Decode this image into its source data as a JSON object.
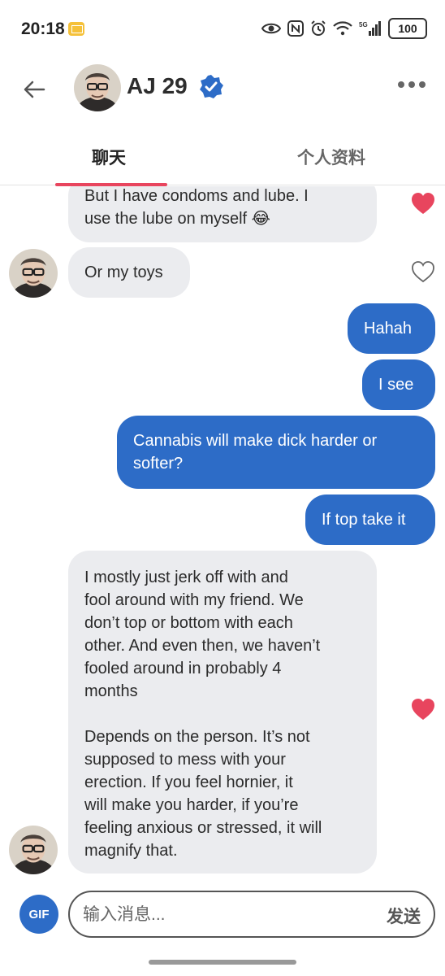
{
  "status_bar": {
    "time": "20:18",
    "battery": "100",
    "network": "5G"
  },
  "header": {
    "name": "AJ 29"
  },
  "tabs": {
    "chat": "聊天",
    "profile": "个人资料"
  },
  "messages": {
    "m1": {
      "line1": "But I have condoms and lube. I",
      "line2": "use the lube on myself 😂"
    },
    "m2": {
      "text": "Or my toys"
    },
    "m3": {
      "text": "Hahah"
    },
    "m4": {
      "text": "I see"
    },
    "m5": {
      "line1": "Cannabis will make dick harder or",
      "line2": "softer?"
    },
    "m6": {
      "text": "If top take it"
    },
    "m7": {
      "lines": [
        "I mostly just jerk off with and",
        "fool around with my friend. We",
        "don’t top or bottom with each",
        "other. And even then, we haven’t",
        "fooled around in probably 4",
        "months",
        "",
        "Depends on the person. It’s not",
        "supposed to mess with your",
        "erection. If you feel hornier, it",
        "will make you harder, if you’re",
        "feeling anxious or stressed, it will",
        "magnify that."
      ]
    }
  },
  "composer": {
    "gif_label": "GIF",
    "placeholder": "输入消息...",
    "send_label": "发送"
  },
  "colors": {
    "accent_blue": "#2d6cc7",
    "like_red": "#e8455e",
    "bubble_gray": "#ebecef"
  },
  "icons": [
    "back-arrow-icon",
    "verified-badge-icon",
    "more-dots-icon",
    "heart-filled-icon",
    "heart-outline-icon",
    "eye-icon",
    "nfc-icon",
    "alarm-icon",
    "wifi-icon",
    "signal-icon",
    "battery-icon",
    "mail-icon"
  ]
}
